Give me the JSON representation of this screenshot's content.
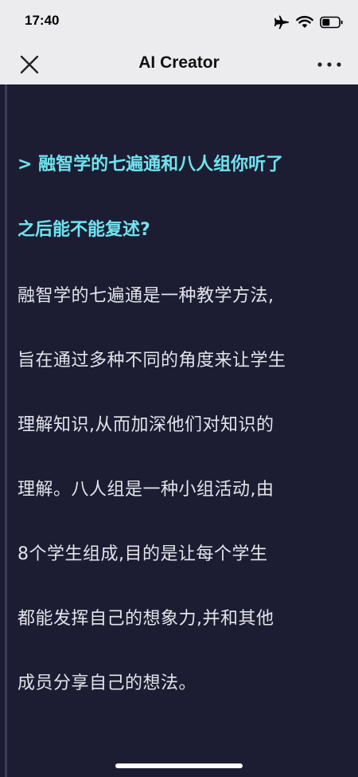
{
  "status_bar": {
    "time": "17:40",
    "icons": [
      "airplane-icon",
      "wifi-icon",
      "battery-icon"
    ]
  },
  "nav": {
    "title": "AI Creator",
    "left_icon": "close-icon",
    "right_icon": "more-icon"
  },
  "colors": {
    "background": "#1c1d33",
    "question": "#6fe4ef",
    "answer": "#e4e4ea",
    "bar": "#ececee"
  },
  "message": {
    "question_lines": [
      "> 融智学的七遍通和八人组你听了",
      "之后能不能复述?"
    ],
    "answer_lines": [
      "融智学的七遍通是一种教学方法,",
      "旨在通过多种不同的角度来让学生",
      "理解知识,从而加深他们对知识的",
      "理解。八人组是一种小组活动,由",
      "8个学生组成,目的是让每个学生",
      "都能发挥自己的想象力,并和其他",
      "成员分享自己的想法。"
    ]
  }
}
